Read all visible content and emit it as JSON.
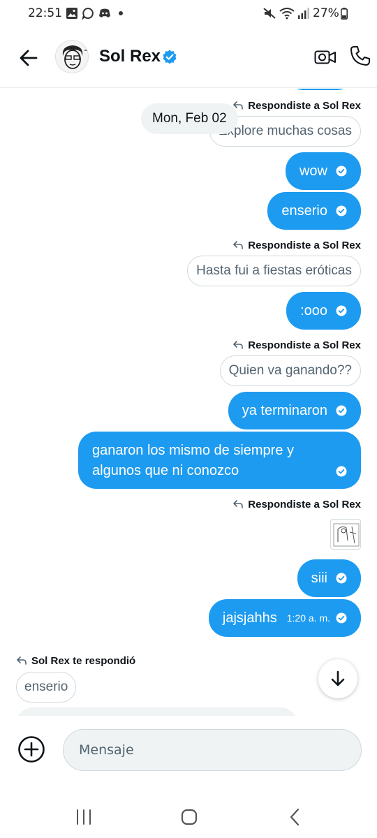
{
  "status": {
    "time": "22:51",
    "battery_pct": "27%"
  },
  "header": {
    "contact_name": "Sol Rex",
    "back_icon": "arrow-left-icon",
    "verified_icon": "verified-badge-icon",
    "video_icon": "video-camera-icon",
    "call_icon": "phone-icon"
  },
  "conversation": {
    "date_separator": "Mon, Feb 02",
    "reply_label_out": "Respondiste a Sol Rex",
    "reply_label_in": "Sol Rex te respondió",
    "quote_1": "Explore muchas cosas",
    "msg_wow": "wow",
    "msg_enserio": "enserio",
    "quote_2": "Hasta fui a fiestas eróticas",
    "msg_ooo": ":ooo",
    "quote_3": "Quien va ganando??",
    "msg_terminaron": "ya terminaron",
    "msg_ganaron_1": "ganaron los mismo de siempre y",
    "msg_ganaron_2": "algunos que ni conozco",
    "msg_siii": "siii",
    "msg_jajs": "jajsjahhs",
    "msg_jajs_time": "1:20 a. m.",
    "quote_in": "enserio"
  },
  "composer": {
    "placeholder": "Mensaje"
  },
  "colors": {
    "accent": "#1d9bf0",
    "text": "#0f1419",
    "muted": "#536471",
    "border": "#cfd9de"
  }
}
